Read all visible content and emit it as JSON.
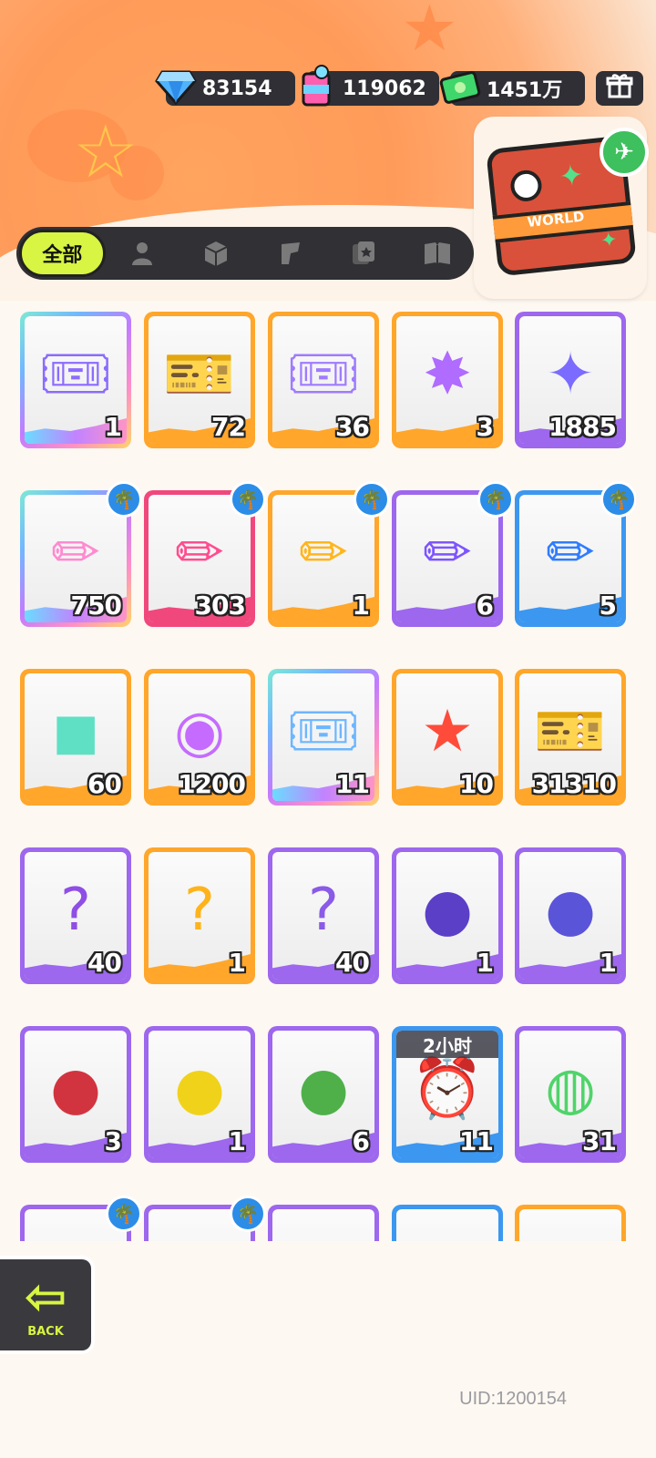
{
  "currencies": {
    "gems": {
      "value": "83154",
      "icon": "diamond-icon"
    },
    "paint": {
      "value": "119062",
      "icon": "paint-can-icon"
    },
    "cash": {
      "value": "1451万",
      "icon": "cash-icon"
    },
    "gift": {
      "icon": "gift-box-icon"
    }
  },
  "world_card": {
    "label": "WORLD"
  },
  "tabs": [
    {
      "label": "全部",
      "active": true
    },
    {
      "icon": "person-icon"
    },
    {
      "icon": "box-icon"
    },
    {
      "icon": "spray-gun-icon"
    },
    {
      "icon": "cards-icon"
    },
    {
      "icon": "book-icon"
    }
  ],
  "items": [
    {
      "count": "1",
      "icon": "purple-ticket-icon",
      "frame": "rainbow"
    },
    {
      "count": "72",
      "icon": "gold-ticket-icon",
      "frame": "orange"
    },
    {
      "count": "36",
      "icon": "purple-star-ticket-icon",
      "frame": "orange"
    },
    {
      "count": "3",
      "icon": "rainbow-star-icon",
      "frame": "orange"
    },
    {
      "count": "1885",
      "icon": "purple-star-icon",
      "frame": "purple"
    },
    {
      "count": "750",
      "icon": "rainbow-crayon-icon",
      "frame": "rainbow",
      "badge": true
    },
    {
      "count": "303",
      "icon": "pink-crayon-icon",
      "frame": "pink",
      "badge": true
    },
    {
      "count": "1",
      "icon": "yellow-crayon-icon",
      "frame": "orange",
      "badge": true
    },
    {
      "count": "6",
      "icon": "purple-crayon-icon",
      "frame": "purple",
      "badge": true
    },
    {
      "count": "5",
      "icon": "blue-crayon-icon",
      "frame": "blue",
      "badge": true
    },
    {
      "count": "60",
      "icon": "color-block-icon",
      "frame": "orange"
    },
    {
      "count": "1200",
      "icon": "cool-sticker-icon",
      "frame": "orange"
    },
    {
      "count": "11",
      "icon": "lottery-ticket-icon",
      "frame": "rainbow"
    },
    {
      "count": "10",
      "icon": "star-badge-icon",
      "frame": "orange"
    },
    {
      "count": "31310",
      "icon": "season-ticket-icon",
      "frame": "orange"
    },
    {
      "count": "40",
      "icon": "mystery-egg-icon",
      "frame": "purple"
    },
    {
      "count": "1",
      "icon": "deity-gold-mystery-icon",
      "frame": "orange"
    },
    {
      "count": "40",
      "icon": "deity-purple-mystery-icon",
      "frame": "purple"
    },
    {
      "count": "1",
      "icon": "bat-orb-icon",
      "frame": "purple"
    },
    {
      "count": "1",
      "icon": "fish-orb-icon",
      "frame": "purple"
    },
    {
      "count": "3",
      "icon": "piranha-orb-icon",
      "frame": "purple"
    },
    {
      "count": "1",
      "icon": "jellyfish-orb-icon",
      "frame": "purple"
    },
    {
      "count": "6",
      "icon": "plant-orb-icon",
      "frame": "purple"
    },
    {
      "count": "11",
      "icon": "alarm-clock-icon",
      "frame": "blue",
      "timer": "2小时"
    },
    {
      "count": "31",
      "icon": "green-jelly-icon",
      "frame": "purple"
    },
    {
      "count": "",
      "icon": "cloud-item-icon",
      "frame": "purple",
      "badge": true
    },
    {
      "count": "",
      "icon": "rainbow-item-icon",
      "frame": "purple",
      "badge": true
    },
    {
      "count": "",
      "icon": "blue-cloud-item-icon",
      "frame": "purple"
    },
    {
      "count": "",
      "icon": "white-item-icon",
      "frame": "blue"
    },
    {
      "count": "",
      "icon": "yellow-item-icon",
      "frame": "orange"
    }
  ],
  "back_button": {
    "label": "BACK"
  },
  "uid": "UID:1200154"
}
